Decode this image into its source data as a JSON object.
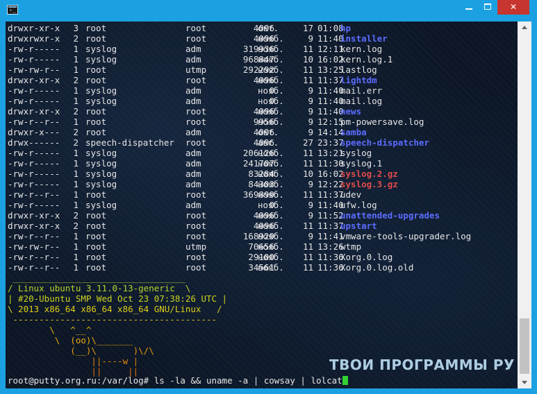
{
  "window": {
    "title": ""
  },
  "listing": [
    {
      "perm": "drwxr-xr-x",
      "links": "3",
      "owner": "root",
      "group": "root",
      "size": "4096",
      "month": "окт.",
      "day": "17",
      "time": "01:08",
      "name": "hp",
      "kind": "dir"
    },
    {
      "perm": "drwxrwxr-x",
      "links": "2",
      "owner": "root",
      "group": "root",
      "size": "4096",
      "month": "нояб.",
      "day": "9",
      "time": "11:40",
      "name": "installer",
      "kind": "dir"
    },
    {
      "perm": "-rw-r-----",
      "links": "1",
      "owner": "syslog",
      "group": "adm",
      "size": "319936",
      "month": "нояб.",
      "day": "11",
      "time": "12:11",
      "name": "kern.log",
      "kind": "file"
    },
    {
      "perm": "-rw-r-----",
      "links": "1",
      "owner": "syslog",
      "group": "adm",
      "size": "968847",
      "month": "нояб.",
      "day": "10",
      "time": "16:02",
      "name": "kern.log.1",
      "kind": "file"
    },
    {
      "perm": "-rw-rw-r--",
      "links": "1",
      "owner": "root",
      "group": "utmp",
      "size": "292292",
      "month": "нояб.",
      "day": "11",
      "time": "13:25",
      "name": "lastlog",
      "kind": "file"
    },
    {
      "perm": "drwxr-xr-x",
      "links": "2",
      "owner": "root",
      "group": "root",
      "size": "4096",
      "month": "нояб.",
      "day": "11",
      "time": "11:37",
      "name": "lightdm",
      "kind": "dir"
    },
    {
      "perm": "-rw-r-----",
      "links": "1",
      "owner": "syslog",
      "group": "adm",
      "size": "0",
      "month": "нояб.",
      "day": "9",
      "time": "11:40",
      "name": "mail.err",
      "kind": "file"
    },
    {
      "perm": "-rw-r-----",
      "links": "1",
      "owner": "syslog",
      "group": "adm",
      "size": "0",
      "month": "нояб.",
      "day": "9",
      "time": "11:40",
      "name": "mail.log",
      "kind": "file"
    },
    {
      "perm": "drwxr-xr-x",
      "links": "2",
      "owner": "root",
      "group": "root",
      "size": "4096",
      "month": "нояб.",
      "day": "9",
      "time": "11:40",
      "name": "news",
      "kind": "dir"
    },
    {
      "perm": "-rw-r--r--",
      "links": "1",
      "owner": "root",
      "group": "root",
      "size": "9956",
      "month": "нояб.",
      "day": "9",
      "time": "12:15",
      "name": "pm-powersave.log",
      "kind": "file"
    },
    {
      "perm": "drwxr-x---",
      "links": "2",
      "owner": "root",
      "group": "adm",
      "size": "4096",
      "month": "окт.",
      "day": "9",
      "time": "14:14",
      "name": "samba",
      "kind": "dir"
    },
    {
      "perm": "drwx------",
      "links": "2",
      "owner": "speech-dispatcher",
      "group": "root",
      "size": "4096",
      "month": "авг.",
      "day": "27",
      "time": "23:37",
      "name": "speech-dispatcher",
      "kind": "dir"
    },
    {
      "perm": "-rw-r-----",
      "links": "1",
      "owner": "syslog",
      "group": "adm",
      "size": "206126",
      "month": "нояб.",
      "day": "11",
      "time": "13:21",
      "name": "syslog",
      "kind": "file"
    },
    {
      "perm": "-rw-r-----",
      "links": "1",
      "owner": "syslog",
      "group": "adm",
      "size": "241707",
      "month": "нояб.",
      "day": "11",
      "time": "11:30",
      "name": "syslog.1",
      "kind": "file"
    },
    {
      "perm": "-rw-r-----",
      "links": "1",
      "owner": "syslog",
      "group": "adm",
      "size": "83284",
      "month": "нояб.",
      "day": "10",
      "time": "16:02",
      "name": "syslog.2.gz",
      "kind": "archive"
    },
    {
      "perm": "-rw-r-----",
      "links": "1",
      "owner": "syslog",
      "group": "adm",
      "size": "84303",
      "month": "нояб.",
      "day": "9",
      "time": "12:22",
      "name": "syslog.3.gz",
      "kind": "archive"
    },
    {
      "perm": "-rw-r--r--",
      "links": "1",
      "owner": "root",
      "group": "root",
      "size": "369899",
      "month": "нояб.",
      "day": "11",
      "time": "11:37",
      "name": "udev",
      "kind": "file"
    },
    {
      "perm": "-rw-r-----",
      "links": "1",
      "owner": "syslog",
      "group": "adm",
      "size": "0",
      "month": "нояб.",
      "day": "9",
      "time": "11:40",
      "name": "ufw.log",
      "kind": "file"
    },
    {
      "perm": "drwxr-xr-x",
      "links": "2",
      "owner": "root",
      "group": "root",
      "size": "4096",
      "month": "нояб.",
      "day": "9",
      "time": "11:52",
      "name": "unattended-upgrades",
      "kind": "dir"
    },
    {
      "perm": "drwxr-xr-x",
      "links": "2",
      "owner": "root",
      "group": "root",
      "size": "4096",
      "month": "нояб.",
      "day": "11",
      "time": "11:37",
      "name": "upstart",
      "kind": "dir"
    },
    {
      "perm": "-rw-r--r--",
      "links": "1",
      "owner": "root",
      "group": "root",
      "size": "168929",
      "month": "нояб.",
      "day": "9",
      "time": "11:41",
      "name": "vmware-tools-upgrader.log",
      "kind": "file"
    },
    {
      "perm": "-rw-rw-r--",
      "links": "1",
      "owner": "root",
      "group": "utmp",
      "size": "70656",
      "month": "нояб.",
      "day": "11",
      "time": "13:26",
      "name": "wtmp",
      "kind": "file"
    },
    {
      "perm": "-rw-r--r--",
      "links": "1",
      "owner": "root",
      "group": "root",
      "size": "29100",
      "month": "нояб.",
      "day": "11",
      "time": "11:36",
      "name": "Xorg.0.log",
      "kind": "file"
    },
    {
      "perm": "-rw-r--r--",
      "links": "1",
      "owner": "root",
      "group": "root",
      "size": "34561",
      "month": "нояб.",
      "day": "11",
      "time": "11:36",
      "name": "Xorg.0.log.old",
      "kind": "file"
    }
  ],
  "cowsay": [
    " _________________________________",
    "/ Linux ubuntu 3.11.0-13-generic  \\",
    "| #20-Ubuntu SMP Wed Oct 23 07:38:26 UTC |",
    "\\ 2013 x86_64 x86_64 x86_64 GNU/Linux   /",
    " ---------------------------------------",
    "        \\   ^__^",
    "         \\  (oo)\\_______",
    "            (__)\\       )\\/\\",
    "                ||----w |",
    "                ||     ||"
  ],
  "cowsay_colors": [
    "#b5d12c",
    "#b9d32a",
    "#cbd31e",
    "#dccd17",
    "#e6c214",
    "#e9b510",
    "#ebaa0e",
    "#e99a0c",
    "#e7860c",
    "#e2700d"
  ],
  "prompt": {
    "text": "root@putty.org.ru:/var/log# ls -la && uname -a | cowsay | lolcat"
  },
  "watermark": "ТВОИ ПРОГРАММЫ РУ",
  "colors": {
    "background": "#0c1625",
    "text": "#e6e6e6",
    "directory": "#5c6cff",
    "archive": "#e04a4a",
    "cursor": "#32d232",
    "frame": "#1ba1e2",
    "close_button": "#c7352f"
  },
  "controls": {
    "minimize_icon": "minimize-icon",
    "maximize_icon": "maximize-icon",
    "close_icon": "close-icon"
  }
}
